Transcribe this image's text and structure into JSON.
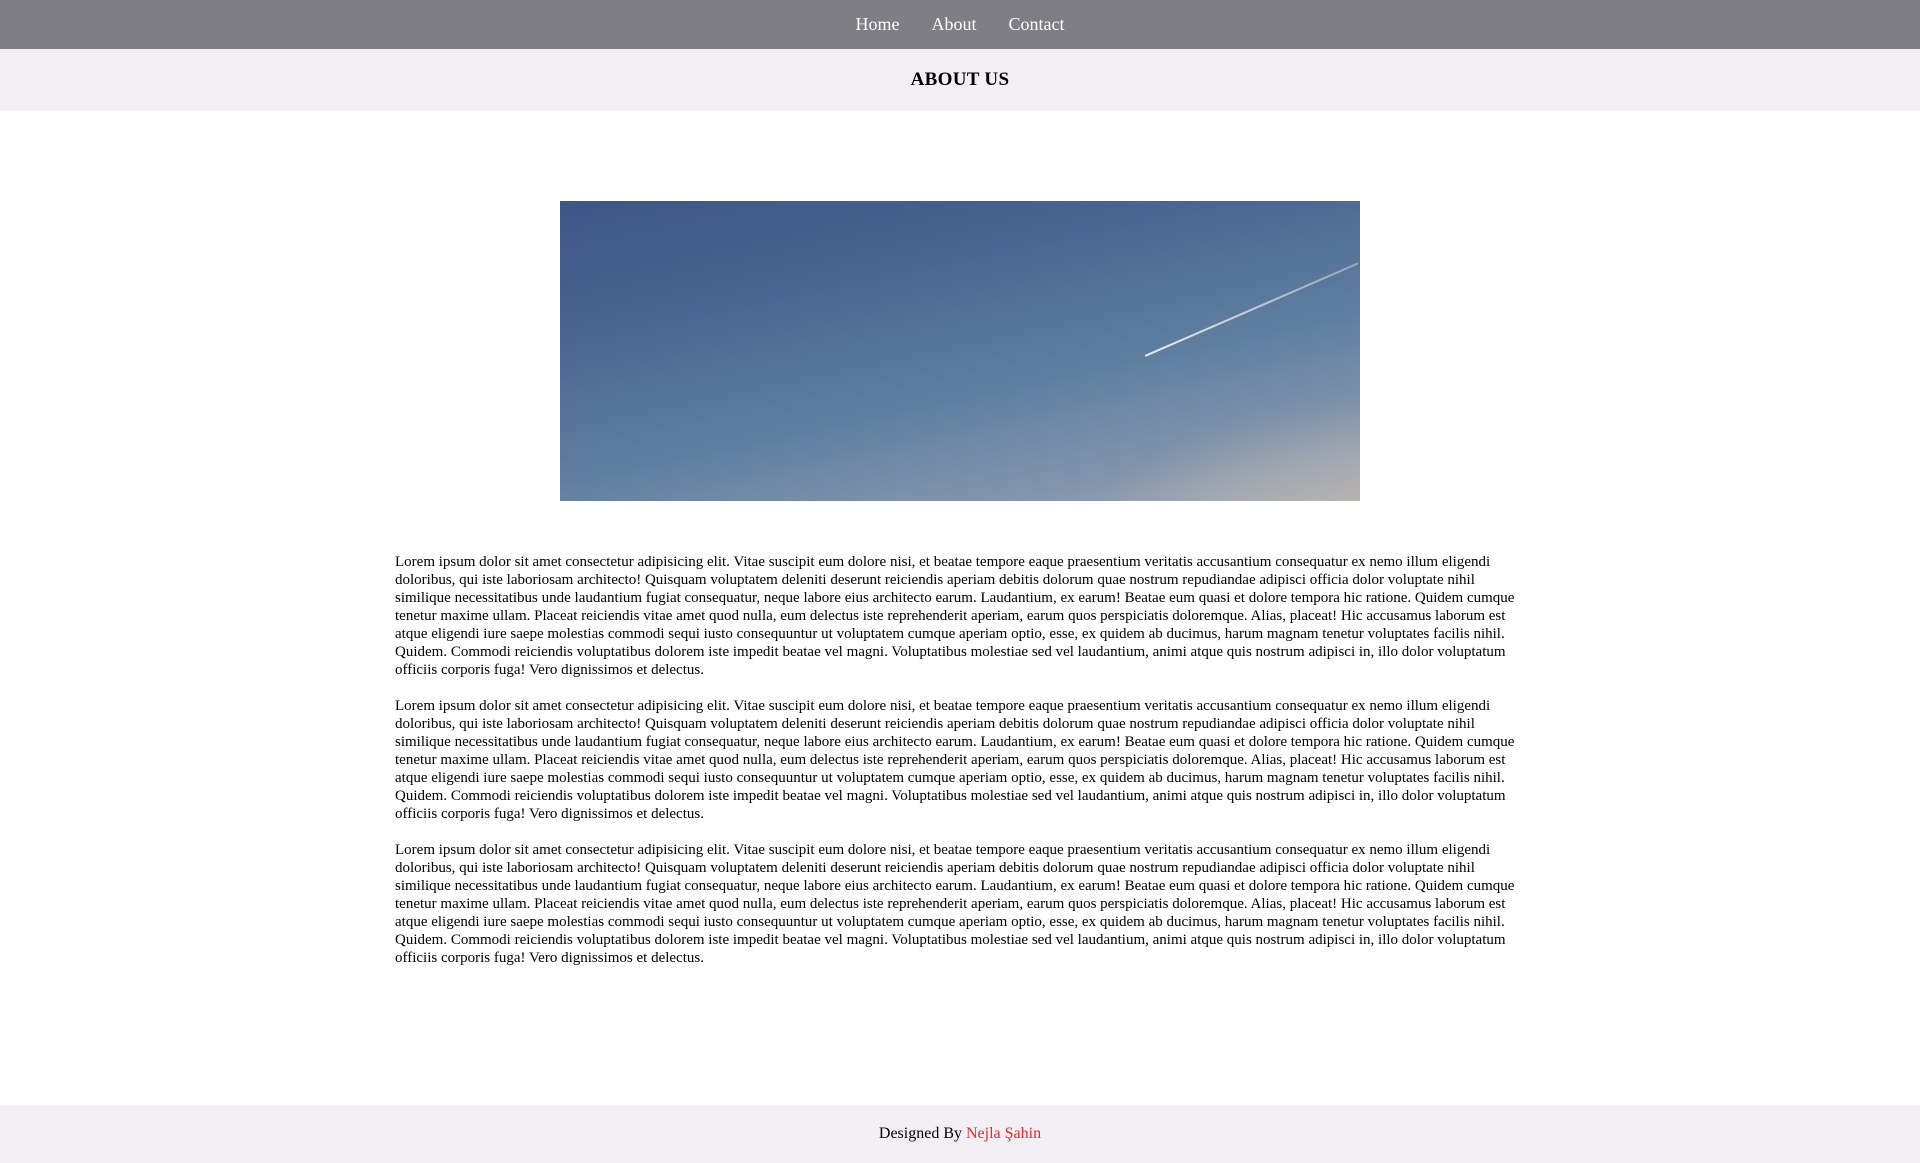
{
  "nav": {
    "items": [
      {
        "label": "Home"
      },
      {
        "label": "About"
      },
      {
        "label": "Contact"
      }
    ]
  },
  "header": {
    "title": "ABOUT US"
  },
  "hero": {
    "image": "sky-photo"
  },
  "content": {
    "paragraphs": [
      "Lorem ipsum dolor sit amet consectetur adipisicing elit. Vitae suscipit eum dolore nisi, et beatae tempore eaque praesentium veritatis accusantium consequatur ex nemo illum eligendi doloribus, qui iste laboriosam architecto! Quisquam voluptatem deleniti deserunt reiciendis aperiam debitis dolorum quae nostrum repudiandae adipisci officia dolor voluptate nihil similique necessitatibus unde laudantium fugiat consequatur, neque labore eius architecto earum. Laudantium, ex earum! Beatae eum quasi et dolore tempora hic ratione. Quidem cumque tenetur maxime ullam. Placeat reiciendis vitae amet quod nulla, eum delectus iste reprehenderit aperiam, earum quos perspiciatis doloremque. Alias, placeat! Hic accusamus laborum est atque eligendi iure saepe molestias commodi sequi iusto consequuntur ut voluptatem cumque aperiam optio, esse, ex quidem ab ducimus, harum magnam tenetur voluptates facilis nihil. Quidem. Commodi reiciendis voluptatibus dolorem iste impedit beatae vel magni. Voluptatibus molestiae sed vel laudantium, animi atque quis nostrum adipisci in, illo dolor voluptatum officiis corporis fuga! Vero dignissimos et delectus.",
      "Lorem ipsum dolor sit amet consectetur adipisicing elit. Vitae suscipit eum dolore nisi, et beatae tempore eaque praesentium veritatis accusantium consequatur ex nemo illum eligendi doloribus, qui iste laboriosam architecto! Quisquam voluptatem deleniti deserunt reiciendis aperiam debitis dolorum quae nostrum repudiandae adipisci officia dolor voluptate nihil similique necessitatibus unde laudantium fugiat consequatur, neque labore eius architecto earum. Laudantium, ex earum! Beatae eum quasi et dolore tempora hic ratione. Quidem cumque tenetur maxime ullam. Placeat reiciendis vitae amet quod nulla, eum delectus iste reprehenderit aperiam, earum quos perspiciatis doloremque. Alias, placeat! Hic accusamus laborum est atque eligendi iure saepe molestias commodi sequi iusto consequuntur ut voluptatem cumque aperiam optio, esse, ex quidem ab ducimus, harum magnam tenetur voluptates facilis nihil. Quidem. Commodi reiciendis voluptatibus dolorem iste impedit beatae vel magni. Voluptatibus molestiae sed vel laudantium, animi atque quis nostrum adipisci in, illo dolor voluptatum officiis corporis fuga! Vero dignissimos et delectus.",
      "Lorem ipsum dolor sit amet consectetur adipisicing elit. Vitae suscipit eum dolore nisi, et beatae tempore eaque praesentium veritatis accusantium consequatur ex nemo illum eligendi doloribus, qui iste laboriosam architecto! Quisquam voluptatem deleniti deserunt reiciendis aperiam debitis dolorum quae nostrum repudiandae adipisci officia dolor voluptate nihil similique necessitatibus unde laudantium fugiat consequatur, neque labore eius architecto earum. Laudantium, ex earum! Beatae eum quasi et dolore tempora hic ratione. Quidem cumque tenetur maxime ullam. Placeat reiciendis vitae amet quod nulla, eum delectus iste reprehenderit aperiam, earum quos perspiciatis doloremque. Alias, placeat! Hic accusamus laborum est atque eligendi iure saepe molestias commodi sequi iusto consequuntur ut voluptatem cumque aperiam optio, esse, ex quidem ab ducimus, harum magnam tenetur voluptates facilis nihil. Quidem. Commodi reiciendis voluptatibus dolorem iste impedit beatae vel magni. Voluptatibus molestiae sed vel laudantium, animi atque quis nostrum adipisci in, illo dolor voluptatum officiis corporis fuga! Vero dignissimos et delectus."
    ]
  },
  "footer": {
    "prefix": "Designed By",
    "author": "Nejla Şahin"
  },
  "colors": {
    "navbar_bg": "#7f7e84",
    "title_bar_bg": "#f1eff4",
    "footer_bg": "#f1eff4",
    "author_link": "#e8262b"
  }
}
